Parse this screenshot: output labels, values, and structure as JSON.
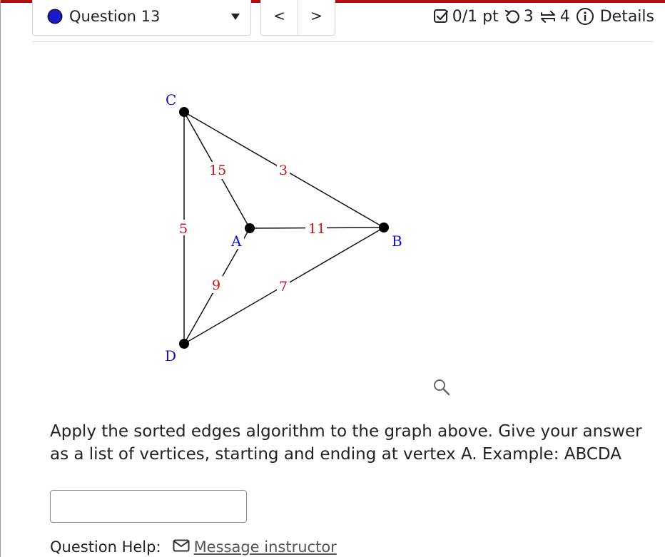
{
  "header": {
    "question_label": "Question 13",
    "question_dot_color": "#1a1acc",
    "prev_label": "<",
    "next_label": ">",
    "score": "0/1 pt",
    "retries": "3",
    "attempts": "4",
    "details": "Details",
    "accent_color": "#b20d11"
  },
  "graph": {
    "vertices": {
      "A": "A",
      "B": "B",
      "C": "C",
      "D": "D"
    },
    "edge_weights": {
      "CA": "15",
      "CB": "3",
      "CD": "5",
      "AB": "11",
      "AD": "9",
      "DB": "7"
    }
  },
  "question": {
    "prompt": "Apply the sorted edges algorithm to the graph above. Give your answer as a list of vertices, starting and ending at vertex A. Example: ABCDA",
    "answer_value": ""
  },
  "help": {
    "label": "Question Help:",
    "message_instructor": "Message instructor"
  }
}
